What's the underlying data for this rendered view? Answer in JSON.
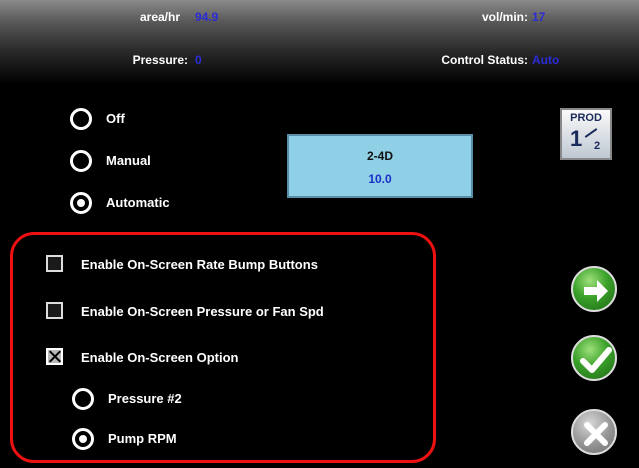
{
  "header": {
    "area_label": "area/hr",
    "area_value": "94.9",
    "vol_label": "vol/min:",
    "vol_value": "17",
    "pressure_label": "Pressure:",
    "pressure_value": "0",
    "control_label": "Control Status:",
    "control_value": "Auto"
  },
  "mode": {
    "options": [
      {
        "label": "Off",
        "selected": false
      },
      {
        "label": "Manual",
        "selected": false
      },
      {
        "label": "Automatic",
        "selected": true
      }
    ]
  },
  "product": {
    "name": "2-4D",
    "rate": "10.0"
  },
  "prod_icon": {
    "top": "PROD",
    "num1": "1",
    "num2": "2"
  },
  "options": {
    "rate_bump": {
      "label": "Enable On-Screen Rate Bump Buttons",
      "checked": false
    },
    "pressure_fan": {
      "label": "Enable On-Screen Pressure or Fan Spd",
      "checked": false
    },
    "onscreen_option": {
      "label": "Enable On-Screen Option",
      "checked": true
    },
    "sub_options": [
      {
        "label": "Pressure #2",
        "selected": false
      },
      {
        "label": "Pump RPM",
        "selected": true
      }
    ]
  },
  "buttons": {
    "next": "arrow-right-icon",
    "accept": "checkmark-icon",
    "cancel": "x-icon"
  },
  "colors": {
    "value_blue": "#2b2bd8",
    "highlight_red": "#e11111",
    "product_box": "#8fd0e6",
    "button_green": "#3aa02a"
  }
}
